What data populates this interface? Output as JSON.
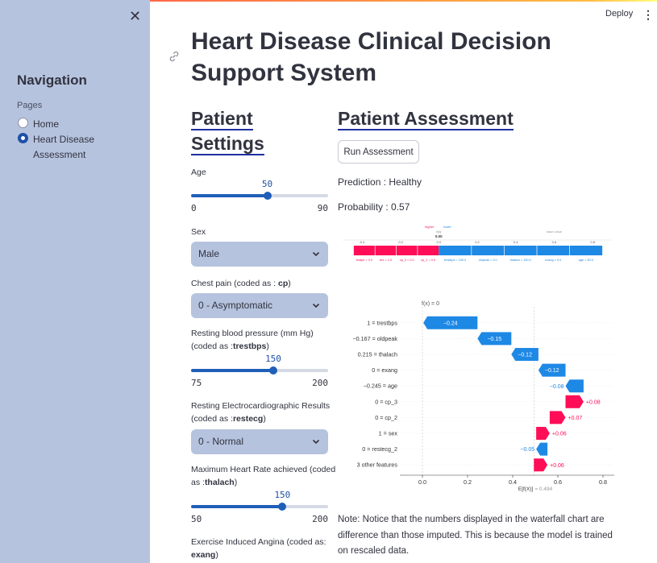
{
  "app": {
    "deploy_label": "Deploy",
    "menu_icon": "⋮"
  },
  "sidebar": {
    "close_icon": "✕",
    "nav_title": "Navigation",
    "pages_label": "Pages",
    "pages": [
      {
        "label": "Home",
        "selected": false
      },
      {
        "label": "Heart Disease Assessment",
        "selected": true
      }
    ]
  },
  "main": {
    "title": "Heart Disease Clinical Decision Support System",
    "settings_heading": "Patient Settings",
    "assessment_heading": "Patient Assessment",
    "run_button": "Run Assessment",
    "prediction_text": "Prediction : Healthy",
    "probability_text": "Probability : 0.57",
    "note": "Note: Notice that the numbers displayed in the waterfall chart are difference than those imputed. This is because the model is trained on rescaled data."
  },
  "settings": {
    "age": {
      "label": "Age",
      "value": "50",
      "min": "0",
      "max": "90",
      "fraction": 0.556
    },
    "sex": {
      "label": "Sex",
      "value": "Male"
    },
    "cp": {
      "label_pre": "Chest pain (coded as : ",
      "label_code": "cp",
      "label_post": ")",
      "value": "0 - Asymptomatic"
    },
    "trestbps": {
      "label_line1": "Resting blood pressure (mm Hg)",
      "label_pre": "(coded as :",
      "label_code": "trestbps",
      "label_post": ")",
      "value": "150",
      "min": "75",
      "max": "200",
      "fraction": 0.6
    },
    "restecg": {
      "label_line1": "Resting Electrocardiographic Results",
      "label_pre": "(coded as :",
      "label_code": "restecg",
      "label_post": ")",
      "value": "0 - Normal"
    },
    "thalach": {
      "label_line1": "Maximum Heart Rate achieved (coded",
      "label_pre": "as :",
      "label_code": "thalach",
      "label_post": ")",
      "value": "150",
      "min": "50",
      "max": "200",
      "fraction": 0.667
    },
    "exang": {
      "label_line1": "Exercise Induced Angina (coded as:",
      "label_code": "exang",
      "label_post": ")"
    }
  },
  "force_plot": {
    "legend_higher": "higher",
    "legend_lower": "lower",
    "fx_label": "f(x)",
    "fx_value": "0.00",
    "base_label": "base value",
    "ticks": [
      "-0.4",
      "-0.2",
      "0.0",
      "0.2",
      "0.4",
      "0.6",
      "0.8"
    ],
    "tick_values": [
      -0.4,
      -0.2,
      0.0,
      0.2,
      0.4,
      0.6,
      0.8
    ],
    "fx": 0.0,
    "red_start": -0.4,
    "blue_end": 0.8,
    "red_features": [
      "thalpe = 0.0",
      "sex = 1.0",
      "cp_3 = 0.0",
      "cp_2 = 0.0"
    ],
    "blue_features": [
      "trestbps = 150.0",
      "oldpeak = 0.0",
      "thalach = 150.0",
      "exang = 0.0",
      "age = 50.0"
    ]
  },
  "chart_data": {
    "type": "bar",
    "subtype": "waterfall",
    "fx_label": "f(x) = 0",
    "ex_label": "E[f(X)]",
    "ex_value": "= 0.494",
    "base_value": 0.494,
    "xlim": [
      -0.1,
      0.85
    ],
    "xticks": [
      0.0,
      0.2,
      0.4,
      0.6,
      0.8
    ],
    "xtick_labels": [
      "0.0",
      "0.2",
      "0.4",
      "0.6",
      "0.8"
    ],
    "colors": {
      "negative": "#1e88e5",
      "positive": "#ff0d57",
      "text": "#555555"
    },
    "rows": [
      {
        "feature": "1 = trestbps",
        "shap": -0.24,
        "label": "−0.24"
      },
      {
        "feature": "−0.167 = oldpeak",
        "shap": -0.15,
        "label": "−0.15"
      },
      {
        "feature": "0.215 = thalach",
        "shap": -0.12,
        "label": "−0.12"
      },
      {
        "feature": "0 = exang",
        "shap": -0.12,
        "label": "−0.12"
      },
      {
        "feature": "−0.245 = age",
        "shap": -0.08,
        "label": "−0.08"
      },
      {
        "feature": "0 = cp_3",
        "shap": 0.08,
        "label": "+0.08"
      },
      {
        "feature": "0 = cp_2",
        "shap": 0.07,
        "label": "+0.07"
      },
      {
        "feature": "1 = sex",
        "shap": 0.06,
        "label": "+0.06"
      },
      {
        "feature": "0 = restecg_2",
        "shap": -0.05,
        "label": "−0.05"
      },
      {
        "feature": "3 other features",
        "shap": 0.06,
        "label": "+0.06"
      }
    ]
  }
}
